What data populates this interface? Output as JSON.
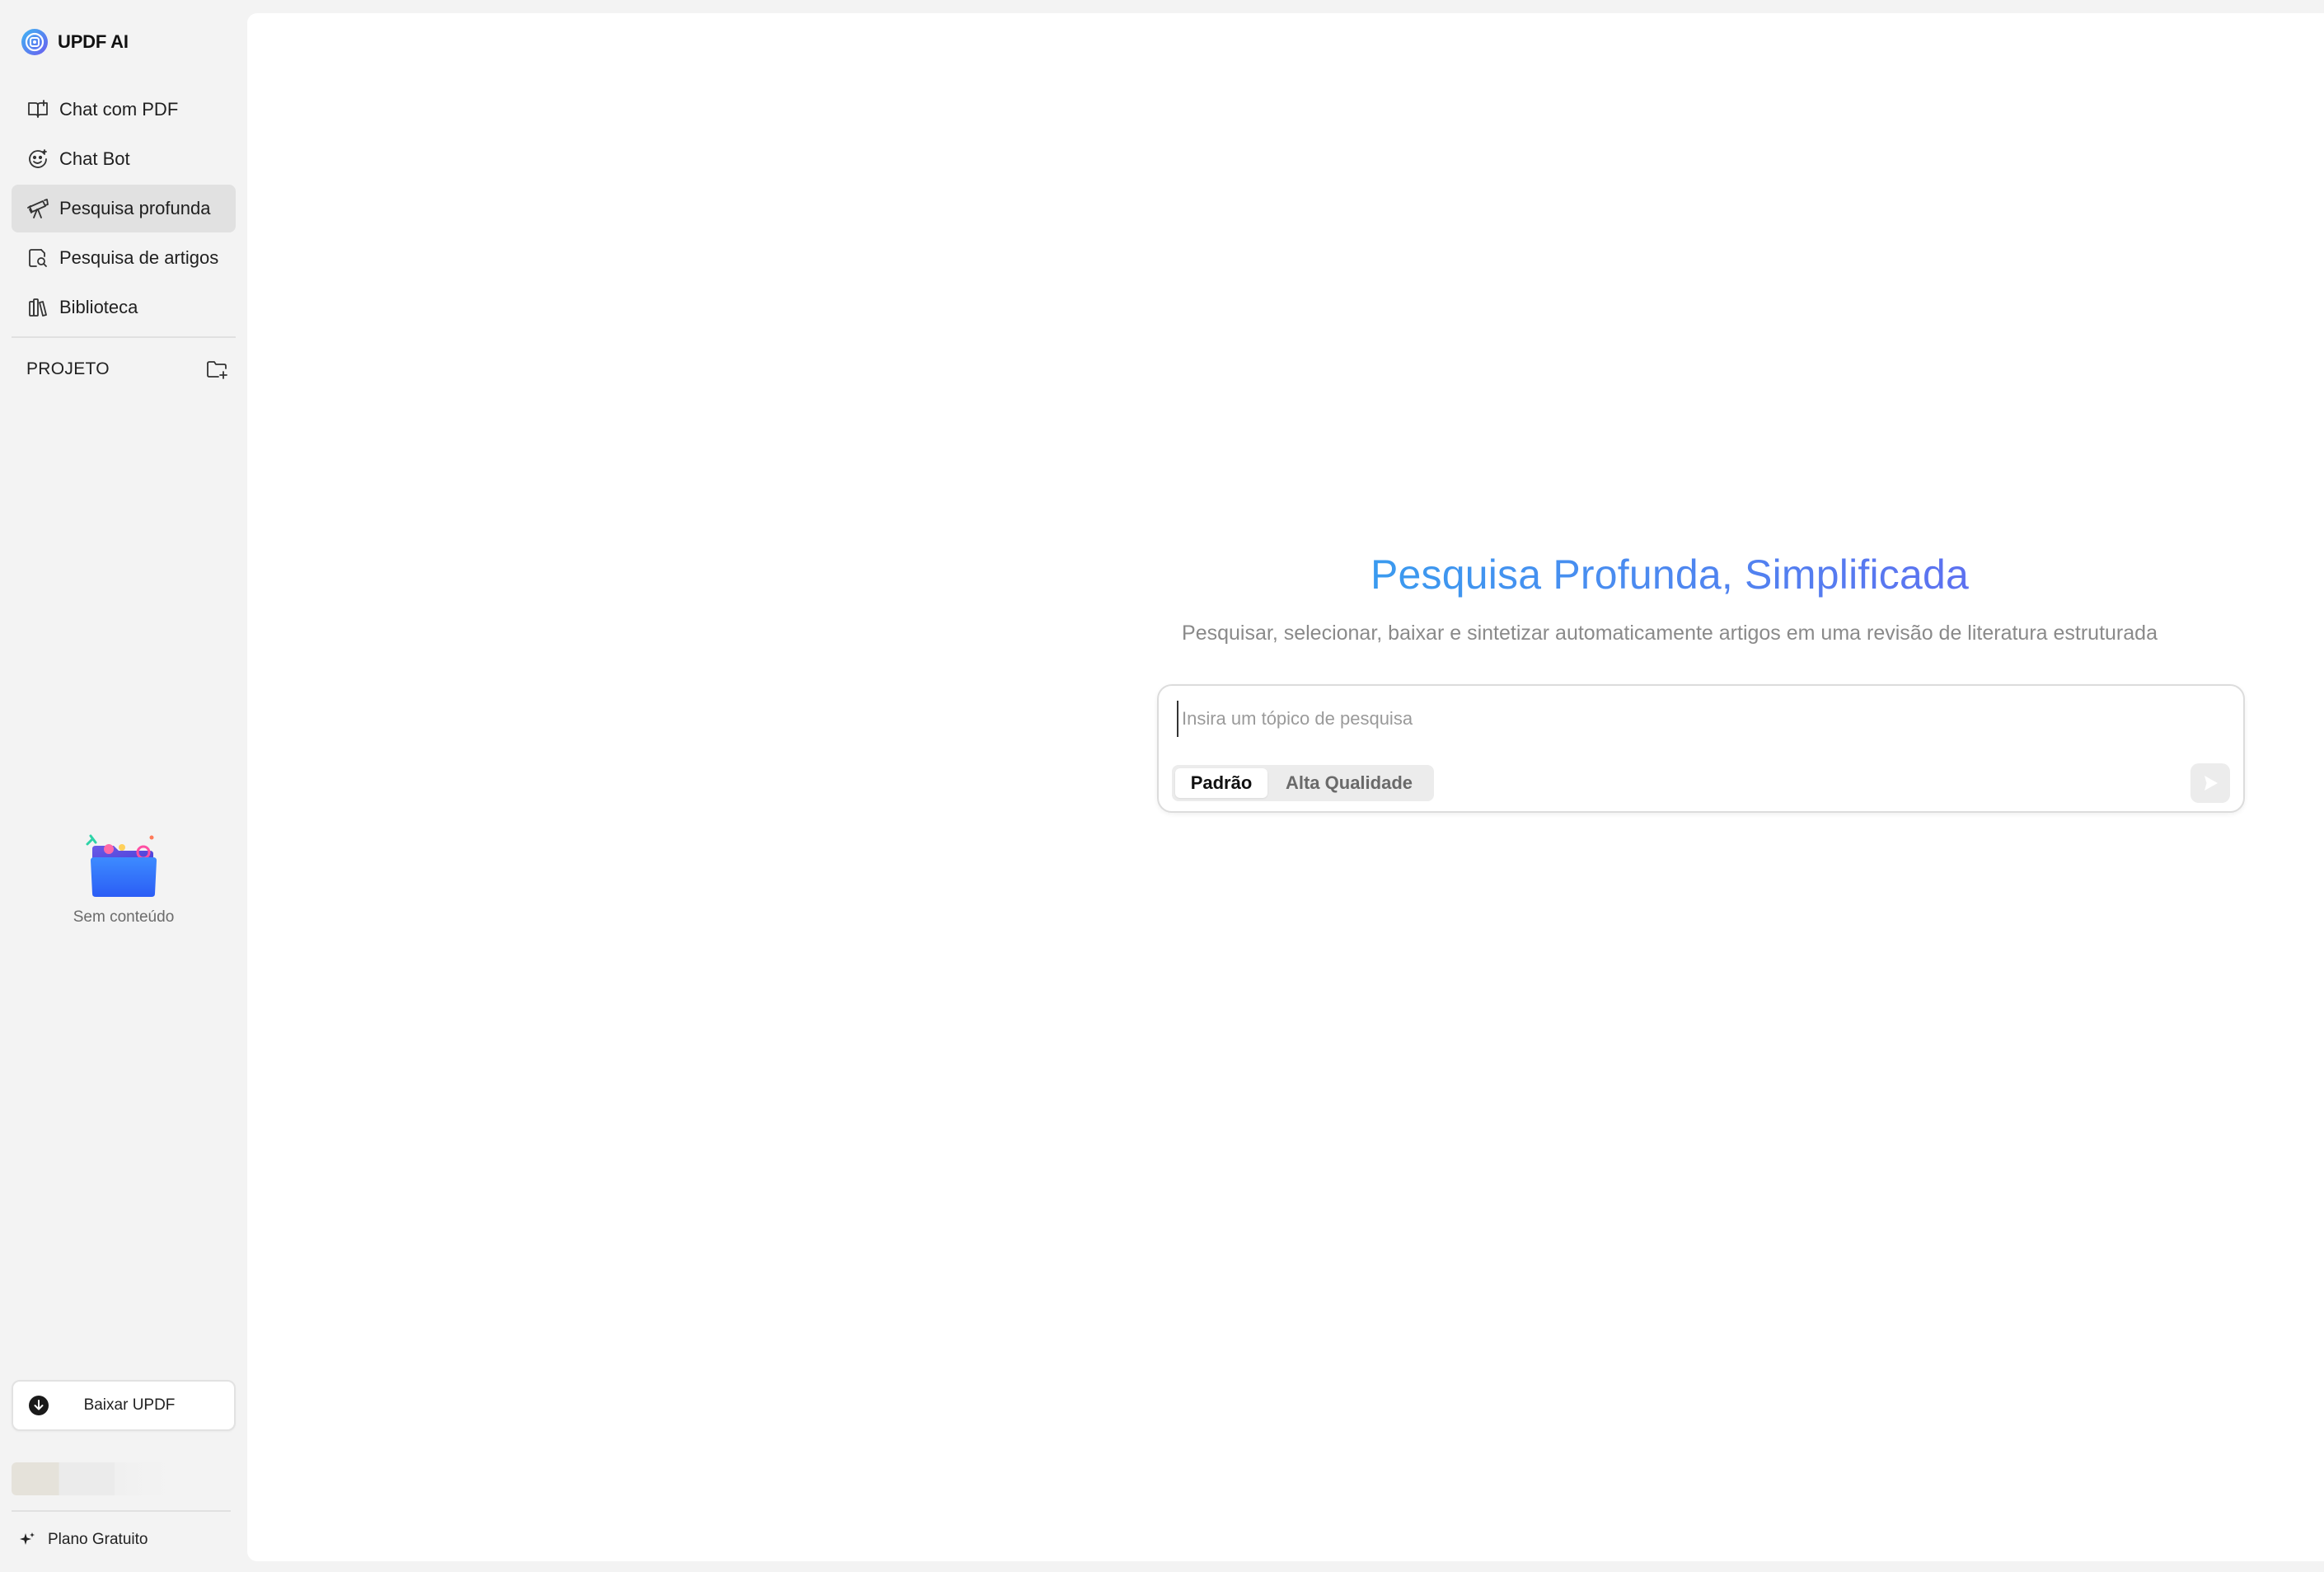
{
  "app": {
    "brand_name": "UPDF AI",
    "accent_color": "#4a8cf0"
  },
  "sidebar": {
    "nav_items": [
      {
        "label": "Chat com PDF",
        "icon": "book-open-icon",
        "active": false
      },
      {
        "label": "Chat Bot",
        "icon": "bot-face-icon",
        "active": false
      },
      {
        "label": "Pesquisa profunda",
        "icon": "telescope-icon",
        "active": true
      },
      {
        "label": "Pesquisa de artigos",
        "icon": "document-search-icon",
        "active": false
      },
      {
        "label": "Biblioteca",
        "icon": "library-icon",
        "active": false
      }
    ],
    "project_label": "PROJETO",
    "new_folder_icon": "folder-plus-icon",
    "empty_text": "Sem conteúdo",
    "download_label": "Baixar UPDF",
    "plan_label": "Plano Gratuito"
  },
  "main": {
    "title": "Pesquisa Profunda, Simplificada",
    "subtitle": "Pesquisar, selecionar, baixar e sintetizar automaticamente artigos em uma revisão de literatura estruturada",
    "search": {
      "placeholder": "Insira um tópico de pesquisa",
      "value": ""
    },
    "modes": [
      {
        "label": "Padrão",
        "selected": true
      },
      {
        "label": "Alta Qualidade",
        "selected": false
      }
    ],
    "send_icon": "send-arrow-icon"
  }
}
